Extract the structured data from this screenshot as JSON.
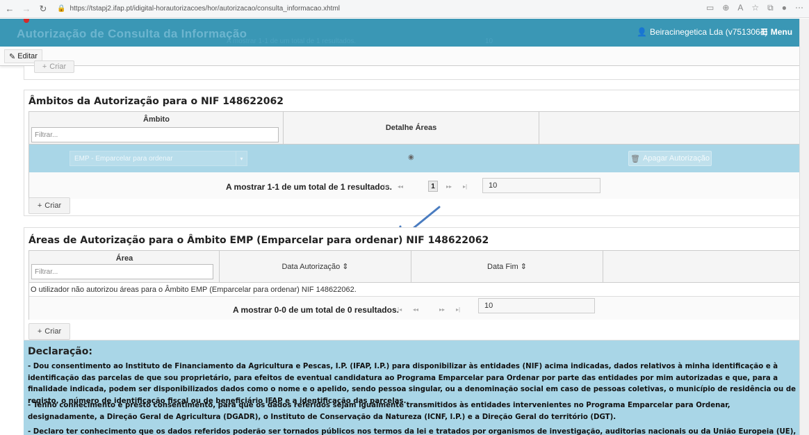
{
  "browser": {
    "url": "https://tstapj2.ifap.pt/idigital-horautorizacoes/hor/autorizacao/consulta_informacao.xhtml"
  },
  "header": {
    "title": "Autorização de Consulta da Informação",
    "ghost_pager": "A mostrar 1-1 de um total de 1 resultados.",
    "ghost_rows": "10",
    "user": "Beiracinegetica Lda (v7513064)",
    "menu": "Menu"
  },
  "toolbar": {
    "edit_label": "Editar"
  },
  "top_partial": {
    "create_label": "Criar"
  },
  "ambitos": {
    "title": "Âmbitos da Autorização para o NIF 148622062",
    "col_ambito": "Âmbito",
    "filter_placeholder": "Filtrar...",
    "col_detalhe": "Detalhe Áreas",
    "row_select_value": "EMP - Emparcelar para ordenar",
    "delete_label": "Apagar Autorização",
    "pager_text": "A mostrar 1-1 de um total de 1 resultados.",
    "current_page": "1",
    "rows_per_page": "10",
    "create_label": "Criar"
  },
  "areas": {
    "title": "Áreas de Autorização para o Âmbito EMP (Emparcelar para ordenar) NIF 148622062",
    "col_area": "Área",
    "filter_placeholder": "Filtrar...",
    "col_data_autorizacao": "Data Autorização ⇕",
    "col_data_fim": "Data Fim ⇕",
    "empty_message": "O utilizador não autorizou áreas para o Âmbito EMP (Emparcelar para ordenar) NIF 148622062.",
    "pager_text": "A mostrar 0-0 de um total de 0 resultados.",
    "rows_per_page": "10",
    "create_label": "Criar"
  },
  "declaracao": {
    "title": "Declaração:",
    "p1": "- Dou consentimento ao Instituto de Financiamento da Agricultura e Pescas, I.P. (IFAP, I.P.) para disponibilizar às entidades (NIF) acima indicadas, dados relativos à minha identificação e à identificação das parcelas de que sou proprietário, para efeitos de eventual candidatura ao Programa Emparcelar para Ordenar por parte das entidades por mim autorizadas e que, para a finalidade indicada, podem ser disponibilizados dados como o nome e o apelido, sendo pessoa singular, ou a denominação social em caso de pessoas coletivas, o município de residência ou de registo, o número de identificação fiscal ou de beneficiário IFAP e a identificação das parcelas.",
    "p2": "- Tenho conhecimento e presto consentimento, para que os dados referidos sejam igualmente transmitidos às entidades intervenientes no Programa Emparcelar para Ordenar, designadamente, a Direção Geral de Agricultura (DGADR), o Instituto de Conservação da Natureza (ICNF, I.P.) e a Direção Geral do território (DGT).",
    "p3": "- Declaro ter conhecimento que os dados referidos poderão ser tornados públicos nos termos da lei e tratados por organismos de investigação, auditorias nacionais ou da União Europeia (UE), para efeitos de controlo do"
  },
  "colors": {
    "header_bg": "#3a97b5",
    "row_selected": "#a9d6e7",
    "arrow": "#4a7cc0"
  }
}
